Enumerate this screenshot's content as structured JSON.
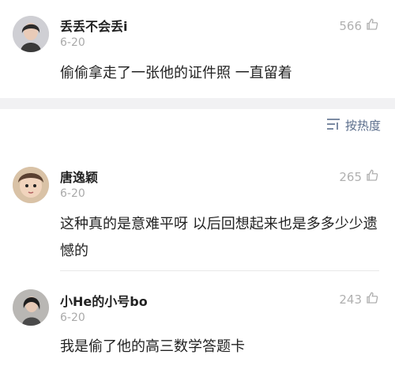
{
  "comments": [
    {
      "username": "丢丢不会丢i",
      "date": "6-20",
      "likes": "566",
      "text": "偷偷拿走了一张他的证件照 一直留着"
    },
    {
      "username": "唐逸颖",
      "date": "6-20",
      "likes": "265",
      "text": "这种真的是意难平呀 以后回想起来也是多多少少遗憾的"
    },
    {
      "username": "小He的小号bo",
      "date": "6-20",
      "likes": "243",
      "text": "我是偷了他的高三数学答题卡"
    }
  ],
  "sort": {
    "label": "按热度",
    "icon": "sort-icon"
  },
  "icons": {
    "like": "thumbs-up-icon"
  },
  "colors": {
    "accent": "#5b6e8c",
    "muted": "#b0b0b0",
    "band": "#f1f1f3"
  }
}
